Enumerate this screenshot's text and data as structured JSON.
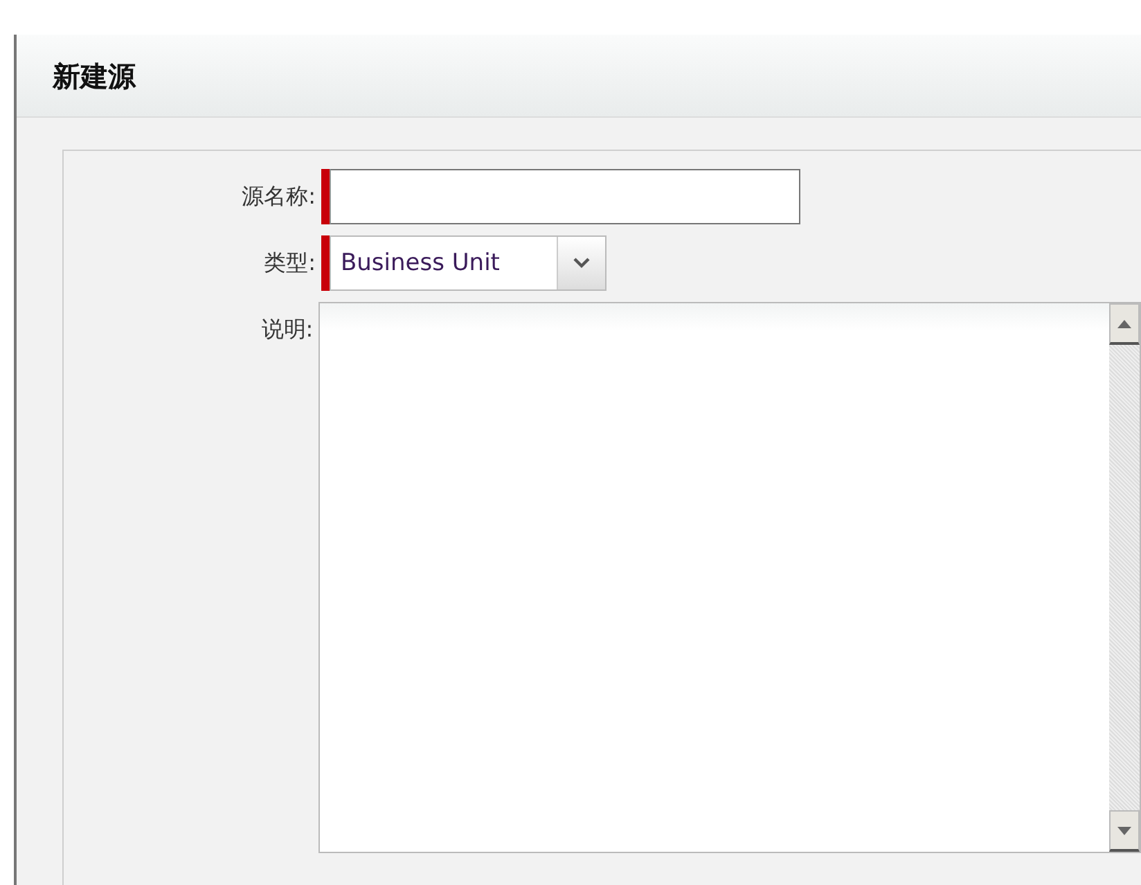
{
  "dialog": {
    "title": "新建源"
  },
  "fields": [
    {
      "kind": "text",
      "label": "源名称:",
      "required": true
    },
    {
      "kind": "select",
      "label": "类型:",
      "required": true,
      "value": "Business Unit"
    },
    {
      "kind": "textarea",
      "label": "说明:",
      "required": false
    }
  ]
}
